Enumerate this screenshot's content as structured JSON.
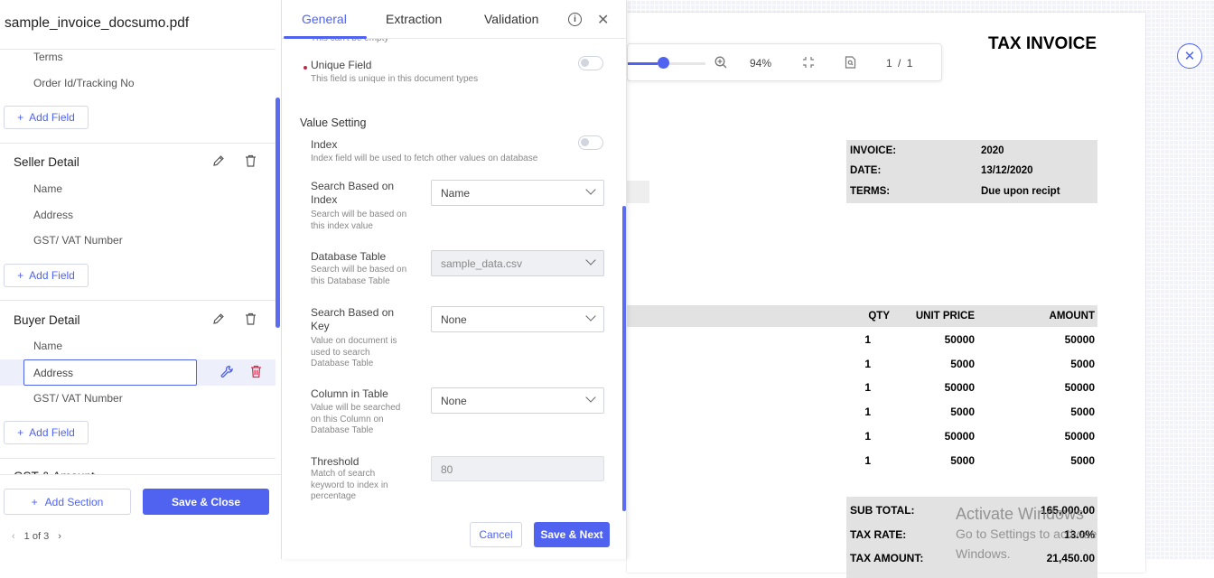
{
  "document": {
    "filename": "sample_invoice_docsumo.pdf",
    "title": "TAX INVOICE",
    "meta": [
      {
        "label": "INVOICE:",
        "value": "2020"
      },
      {
        "label": "DATE:",
        "value": "13/12/2020"
      },
      {
        "label": "TERMS:",
        "value": "Due upon recipt"
      }
    ],
    "columns": {
      "qty": "QTY",
      "unit_price": "UNIT PRICE",
      "amount": "AMOUNT"
    },
    "items": [
      {
        "qty": "1",
        "unit_price": "50000",
        "amount": "50000"
      },
      {
        "qty": "1",
        "unit_price": "5000",
        "amount": "5000"
      },
      {
        "qty": "1",
        "unit_price": "50000",
        "amount": "50000"
      },
      {
        "qty": "1",
        "unit_price": "5000",
        "amount": "5000"
      },
      {
        "qty": "1",
        "unit_price": "50000",
        "amount": "50000"
      },
      {
        "qty": "1",
        "unit_price": "5000",
        "amount": "5000"
      }
    ],
    "totals": [
      {
        "label": "SUB TOTAL:",
        "value": "165,000.00"
      },
      {
        "label": "TAX RATE:",
        "value": "13.0%"
      },
      {
        "label": "TAX AMOUNT:",
        "value": "21,450.00"
      }
    ]
  },
  "watermark": {
    "line1": "Activate Windows",
    "line2": "Go to Settings to activate Windows."
  },
  "viewer": {
    "zoom_level": "94%",
    "zoom_fraction": 0.38,
    "page_current": "1",
    "page_sep": "/",
    "page_total": "1"
  },
  "left_panel": {
    "top_items": [
      "Terms",
      "Order Id/Tracking No"
    ],
    "add_field": "Add Field",
    "sections": [
      {
        "title": "Seller Detail",
        "items": [
          "Name",
          "Address",
          "GST/ VAT Number"
        ]
      },
      {
        "title": "Buyer Detail",
        "items": [
          "Name",
          "Address",
          "GST/ VAT Number"
        ]
      },
      {
        "title": "GST & Amount"
      }
    ],
    "active_field_value": "Address",
    "add_section": "Add Section",
    "save_close": "Save & Close",
    "pager": "1 of 3"
  },
  "settings_panel": {
    "tabs": [
      "General",
      "Extraction",
      "Validation"
    ],
    "cut_text": "This can't be empty",
    "unique_field": {
      "label": "Unique Field",
      "hint": "This field is unique in this document types"
    },
    "value_setting_heading": "Value Setting",
    "index": {
      "label": "Index",
      "hint": "Index field will be used to fetch other values on database"
    },
    "search_based_on_index": {
      "label": "Search Based on Index",
      "hint": "Search will be based on this index value",
      "value": "Name"
    },
    "database_table": {
      "label": "Database Table",
      "hint": "Search will be based on this Database Table",
      "value": "sample_data.csv"
    },
    "search_based_on_key": {
      "label": "Search Based on Key",
      "hint": "Value on document is used to search Database Table",
      "value": "None"
    },
    "column_in_table": {
      "label": "Column in Table",
      "hint": "Value will be searched on this Column on Database Table",
      "value": "None"
    },
    "threshold": {
      "label": "Threshold",
      "hint": "Match of search keyword to index in percentage",
      "value": "80"
    },
    "cancel": "Cancel",
    "save_next": "Save & Next"
  },
  "colors": {
    "accent": "#4f63f0",
    "danger": "#d9304f"
  }
}
